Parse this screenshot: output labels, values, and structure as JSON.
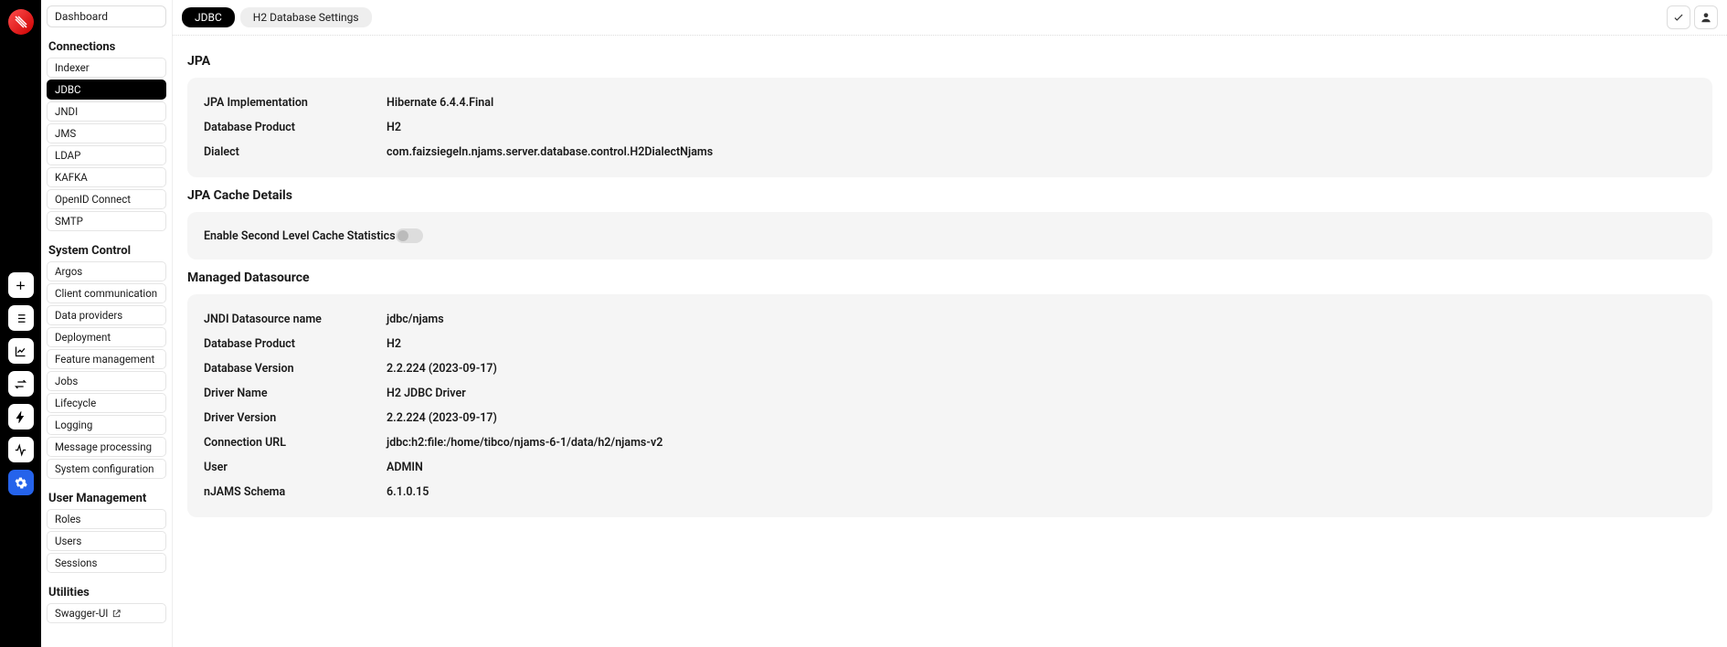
{
  "sidebar": {
    "dashboard": "Dashboard",
    "sections": [
      {
        "heading": "Connections",
        "items": [
          {
            "label": "Indexer",
            "active": false
          },
          {
            "label": "JDBC",
            "active": true
          },
          {
            "label": "JNDI",
            "active": false
          },
          {
            "label": "JMS",
            "active": false
          },
          {
            "label": "LDAP",
            "active": false
          },
          {
            "label": "KAFKA",
            "active": false
          },
          {
            "label": "OpenID Connect",
            "active": false
          },
          {
            "label": "SMTP",
            "active": false
          }
        ]
      },
      {
        "heading": "System Control",
        "items": [
          {
            "label": "Argos"
          },
          {
            "label": "Client communication"
          },
          {
            "label": "Data providers"
          },
          {
            "label": "Deployment"
          },
          {
            "label": "Feature management"
          },
          {
            "label": "Jobs"
          },
          {
            "label": "Lifecycle"
          },
          {
            "label": "Logging"
          },
          {
            "label": "Message processing"
          },
          {
            "label": "System configuration"
          }
        ]
      },
      {
        "heading": "User Management",
        "items": [
          {
            "label": "Roles"
          },
          {
            "label": "Users"
          },
          {
            "label": "Sessions"
          }
        ]
      },
      {
        "heading": "Utilities",
        "items": [
          {
            "label": "Swagger-UI",
            "ext": true
          }
        ]
      }
    ]
  },
  "tabs": [
    {
      "label": "JDBC",
      "active": true
    },
    {
      "label": "H2 Database Settings",
      "active": false
    }
  ],
  "sections": {
    "jpa": {
      "heading": "JPA",
      "rows": [
        {
          "label": "JPA Implementation",
          "value": "Hibernate 6.4.4.Final"
        },
        {
          "label": "Database Product",
          "value": "H2"
        },
        {
          "label": "Dialect",
          "value": "com.faizsiegeln.njams.server.database.control.H2DialectNjams"
        }
      ]
    },
    "cache": {
      "heading": "JPA Cache Details",
      "toggleLabel": "Enable Second Level Cache Statistics",
      "toggleOn": false
    },
    "ds": {
      "heading": "Managed Datasource",
      "rows": [
        {
          "label": "JNDI Datasource name",
          "value": "jdbc/njams"
        },
        {
          "label": "Database Product",
          "value": "H2"
        },
        {
          "label": "Database Version",
          "value": "2.2.224 (2023-09-17)"
        },
        {
          "label": "Driver Name",
          "value": "H2 JDBC Driver"
        },
        {
          "label": "Driver Version",
          "value": "2.2.224 (2023-09-17)"
        },
        {
          "label": "Connection URL",
          "value": "jdbc:h2:file:/home/tibco/njams-6-1/data/h2/njams-v2"
        },
        {
          "label": "User",
          "value": "ADMIN"
        },
        {
          "label": "nJAMS Schema",
          "value": "6.1.0.15"
        }
      ]
    }
  }
}
